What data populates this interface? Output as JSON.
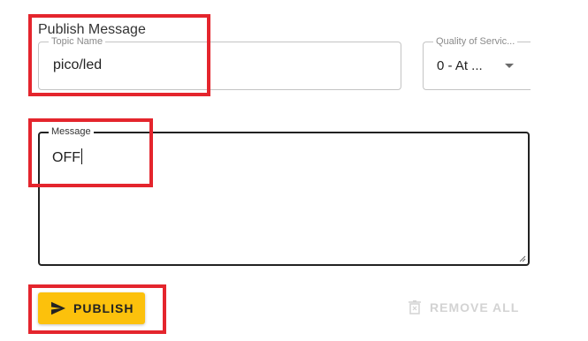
{
  "section": {
    "title": "Publish Message"
  },
  "topic": {
    "label": "Topic Name",
    "value": "pico/led"
  },
  "qos": {
    "label": "Quality of Servic...",
    "value": "0 - At ..."
  },
  "message": {
    "label": "Message",
    "value": "OFF"
  },
  "actions": {
    "publish_label": "PUBLISH",
    "remove_all_label": "REMOVE ALL"
  },
  "icons": {
    "publish": "send-icon",
    "remove_all": "trash-icon",
    "qos_dropdown": "caret-down-icon"
  },
  "colors": {
    "publish_button": "#fcc10c",
    "annotation": "#e4252d",
    "disabled_text": "#d3d3d3"
  },
  "states": {
    "remove_all_disabled": true
  }
}
